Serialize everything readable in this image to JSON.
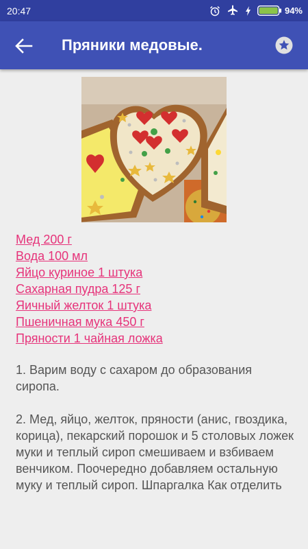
{
  "status_bar": {
    "time": "20:47",
    "icons": [
      "alarm-icon",
      "airplane-mode-icon",
      "charging-bolt-icon",
      "battery-icon"
    ],
    "battery_percent": "94%",
    "color": "#303f9f"
  },
  "app_bar": {
    "title": "Пряники медовые.",
    "back_icon": "arrow-back-icon",
    "favorite_icon": "star-icon",
    "color": "#3f51b5"
  },
  "recipe": {
    "image": "honey-gingerbread-cookies-photo",
    "link_color": "#e6337a",
    "ingredients": [
      "Мед 200 г",
      "Вода 100 мл",
      "Яйцо куриное 1 штука",
      "Сахарная пудра 125 г",
      "Яичный желток 1 штука",
      "Пшеничная мука 450 г",
      "Пряности 1 чайная ложка"
    ],
    "steps": [
      "1. Варим воду с сахаром до образования сиропа.",
      "2. Мед, яйцо, желток, пряности (анис, гвоздика, корица), пекарский порошок и 5 столовых ложек муки и теплый сироп смешиваем и взбиваем венчиком. Поочередно добавляем остальную муку и теплый сироп. Шпаргалка Как отделить"
    ]
  }
}
